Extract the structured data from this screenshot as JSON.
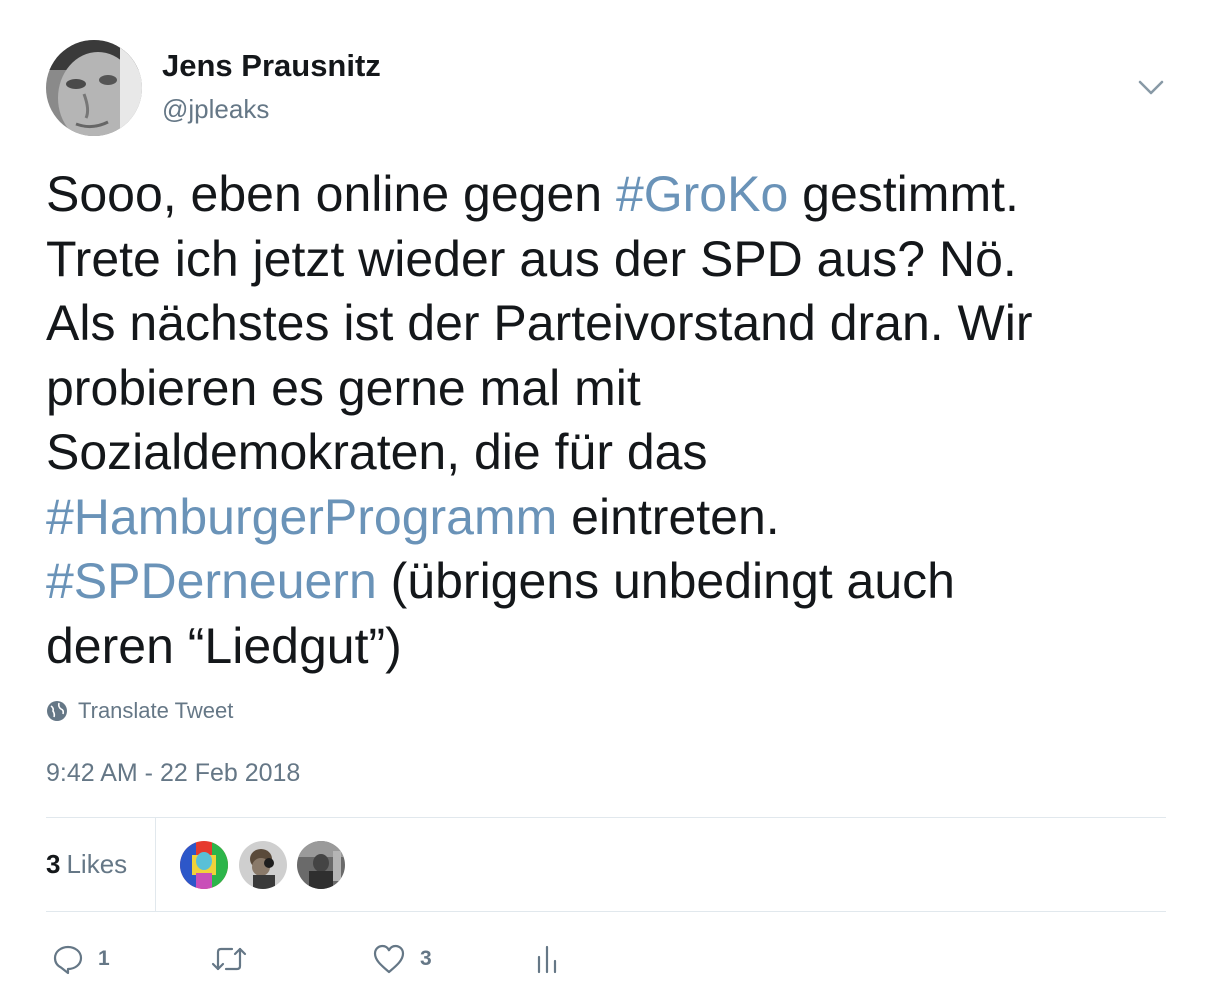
{
  "author": {
    "display_name": "Jens Prausnitz",
    "handle": "@jpleaks"
  },
  "tweet": {
    "lines": [
      [
        {
          "text": "Sooo, eben online gegen "
        },
        {
          "text": "#GroKo",
          "hashtag": true
        },
        {
          "text": " gestimmt."
        }
      ],
      [
        {
          "text": "Trete ich jetzt wieder aus der SPD aus? Nö."
        }
      ],
      [
        {
          "text": "Als nächstes ist der Parteivorstand dran. Wir"
        }
      ],
      [
        {
          "text": "probieren es gerne mal mit"
        }
      ],
      [
        {
          "text": "Sozialdemokraten, die für das"
        }
      ],
      [
        {
          "text": "#HamburgerProgramm",
          "hashtag": true
        },
        {
          "text": " eintreten."
        }
      ],
      [
        {
          "text": "#SPDerneuern",
          "hashtag": true
        },
        {
          "text": " (übrigens unbedingt auch"
        }
      ],
      [
        {
          "text": "deren “Liedgut”)"
        }
      ]
    ],
    "hashtag_color": "#6a93b8"
  },
  "translate": {
    "label": "Translate Tweet",
    "icon": "globe-icon"
  },
  "timestamp": "9:42 AM - 22 Feb 2018",
  "stats": {
    "likes_count": "3",
    "likes_label": "Likes"
  },
  "actions": {
    "reply_count": "1",
    "retweet_count": "",
    "like_count": "3",
    "icons": [
      "reply-icon",
      "retweet-icon",
      "heart-icon",
      "analytics-icon"
    ]
  },
  "colors": {
    "text": "#14171a",
    "secondary": "#657786",
    "divider": "#e1e8ed"
  }
}
